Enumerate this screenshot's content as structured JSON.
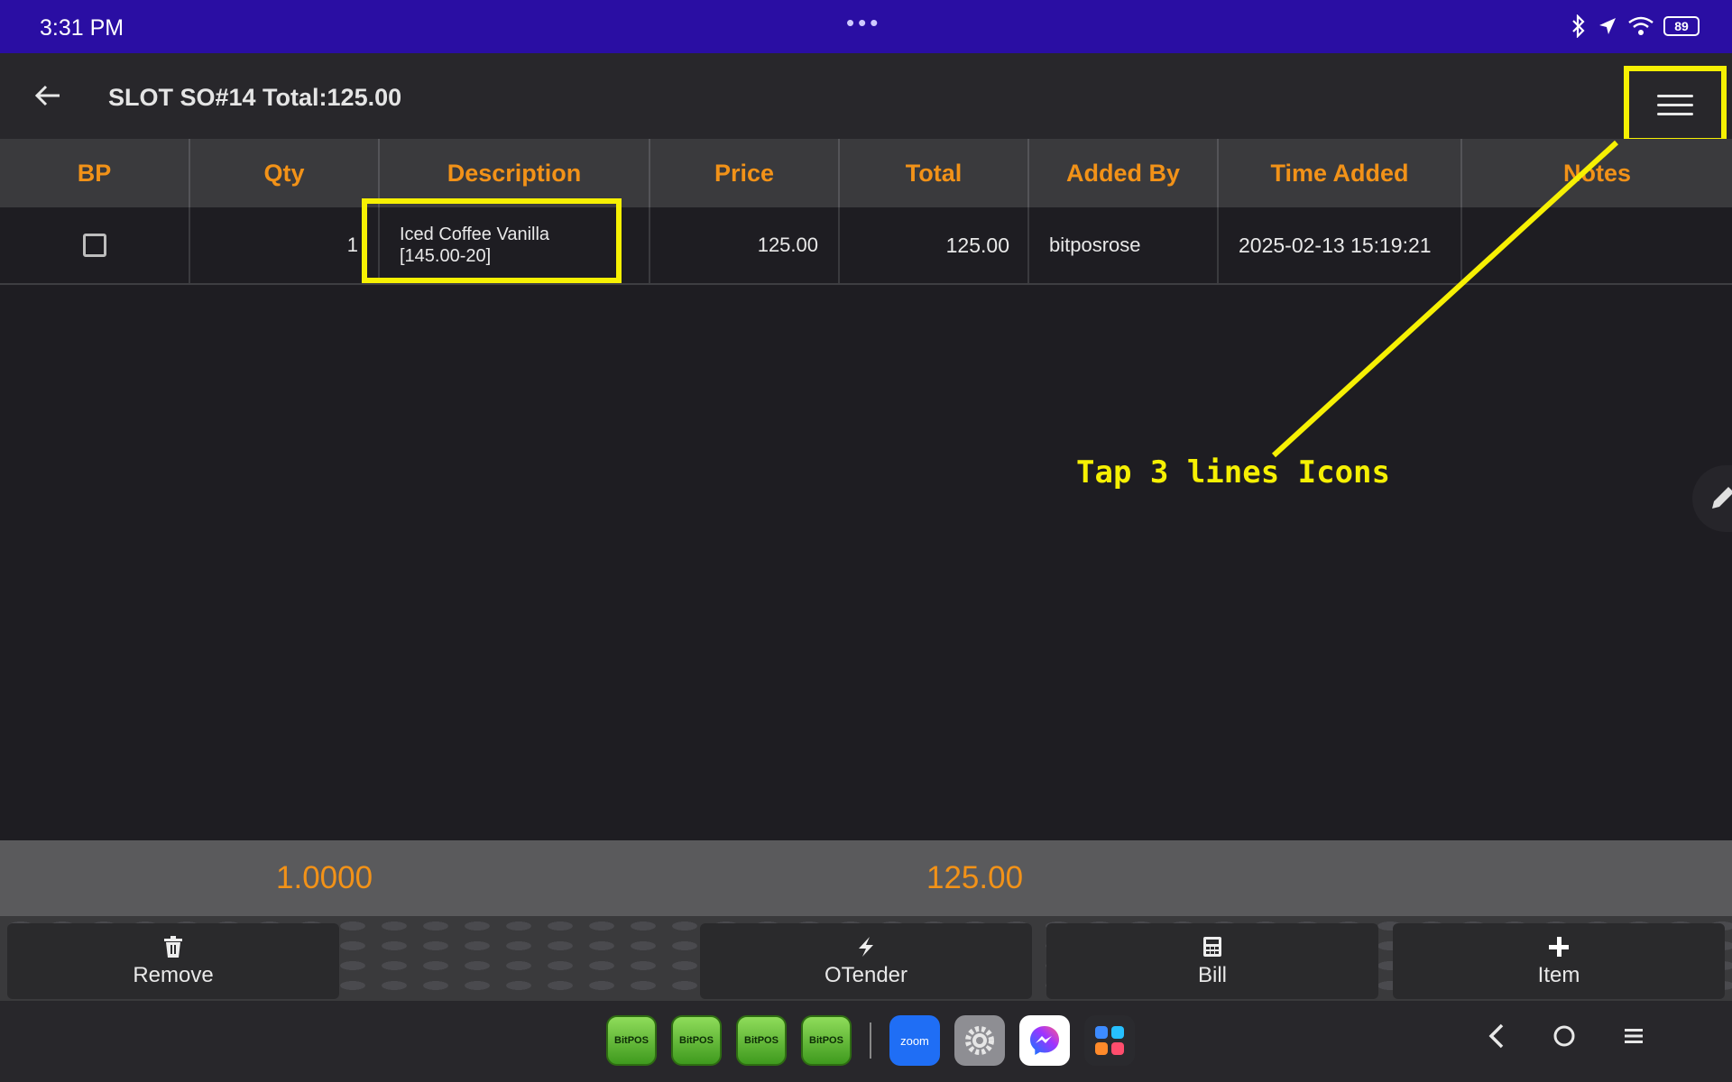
{
  "status": {
    "time": "3:31 PM",
    "dots": "•••",
    "battery": "89"
  },
  "app_bar": {
    "title": "SLOT SO#14 Total:125.00"
  },
  "table": {
    "columns": [
      "BP",
      "Qty",
      "Description",
      "Price",
      "Total",
      "Added By",
      "Time Added",
      "Notes"
    ],
    "rows": [
      {
        "qty": "1",
        "description_line1": "Iced Coffee Vanilla",
        "description_line2": "[145.00-20]",
        "price": "125.00",
        "total": "125.00",
        "added_by": "bitposrose",
        "time_added": "2025-02-13 15:19:21",
        "notes": ""
      }
    ]
  },
  "annotation": {
    "text": "Tap 3 lines Icons",
    "color": "#f6f003"
  },
  "totals": {
    "qty": "1.0000",
    "amount": "125.00"
  },
  "actions": {
    "remove": "Remove",
    "otender": "OTender",
    "bill": "Bill",
    "item": "Item"
  },
  "dock": {
    "apps": [
      "BitPOS",
      "BitPOS",
      "BitPOS",
      "BitPOS"
    ],
    "zoom": "zoom"
  },
  "colors": {
    "accent": "#f29218",
    "status_bar": "#2a0ea3",
    "highlight": "#f6f003"
  }
}
